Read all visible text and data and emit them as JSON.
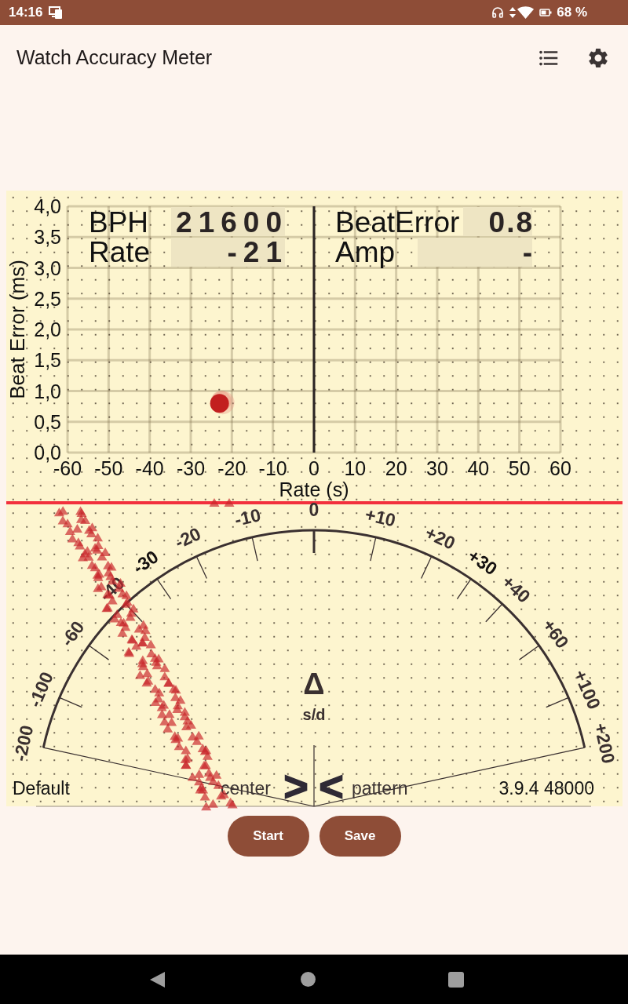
{
  "status_bar": {
    "time": "14:16",
    "battery": "68 %"
  },
  "app_bar": {
    "title": "Watch Accuracy Meter"
  },
  "chart_panel": {
    "readouts": [
      {
        "label": "BPH",
        "value": "21600"
      },
      {
        "label": "Rate",
        "value": "-21"
      },
      {
        "label": "BeatError",
        "value": "0.8"
      },
      {
        "label": "Amp",
        "value": "-"
      }
    ],
    "chart_data": {
      "type": "scatter",
      "xlabel": "Rate (s)",
      "ylabel": "Beat Error (ms)",
      "x": [
        -23
      ],
      "values": [
        0.8
      ],
      "xlim": [
        -60,
        60
      ],
      "ylim": [
        0,
        4
      ],
      "grid": true,
      "xticks": [
        {
          "value": -60,
          "label": "-60"
        },
        {
          "value": -50,
          "label": "-50"
        },
        {
          "value": -40,
          "label": "-40"
        },
        {
          "value": -30,
          "label": "-30"
        },
        {
          "value": -20,
          "label": "-20"
        },
        {
          "value": -10,
          "label": "-10"
        },
        {
          "value": 0,
          "label": "0"
        },
        {
          "value": 10,
          "label": "10"
        },
        {
          "value": 20,
          "label": "20"
        },
        {
          "value": 30,
          "label": "30"
        },
        {
          "value": 40,
          "label": "40"
        },
        {
          "value": 50,
          "label": "50"
        },
        {
          "value": 60,
          "label": "60"
        }
      ],
      "yticks": [
        {
          "value": 0,
          "label": "0,0"
        },
        {
          "value": 0.5,
          "label": "0,5"
        },
        {
          "value": 1,
          "label": "1,0"
        },
        {
          "value": 1.5,
          "label": "1,5"
        },
        {
          "value": 2,
          "label": "2,0"
        },
        {
          "value": 2.5,
          "label": "2,5"
        },
        {
          "value": 3,
          "label": "3,0"
        },
        {
          "value": 3.5,
          "label": "3,5"
        },
        {
          "value": 4,
          "label": "4,0"
        }
      ]
    }
  },
  "dial": {
    "scale": [
      {
        "label": "-200",
        "emphasized": false
      },
      {
        "label": "-100",
        "emphasized": false
      },
      {
        "label": "-60",
        "emphasized": false
      },
      {
        "label": "-40",
        "emphasized": false
      },
      {
        "label": "-30",
        "emphasized": true
      },
      {
        "label": "-20",
        "emphasized": false
      },
      {
        "label": "-10",
        "emphasized": false
      },
      {
        "label": "0",
        "emphasized": false
      },
      {
        "label": "+10",
        "emphasized": false
      },
      {
        "label": "+20",
        "emphasized": false
      },
      {
        "label": "+30",
        "emphasized": true
      },
      {
        "label": "+40",
        "emphasized": false
      },
      {
        "label": "+60",
        "emphasized": false
      },
      {
        "label": "+100",
        "emphasized": false
      },
      {
        "label": "+200",
        "emphasized": false
      }
    ],
    "symbol": "Δ",
    "unit": "s/d"
  },
  "footer": {
    "profile": "Default",
    "left_label": "center",
    "left_marker": ">",
    "right_marker": "<",
    "right_label": "pattern",
    "version": "3.9.4 48000"
  },
  "buttons": [
    {
      "label": "Start"
    },
    {
      "label": "Save"
    }
  ]
}
